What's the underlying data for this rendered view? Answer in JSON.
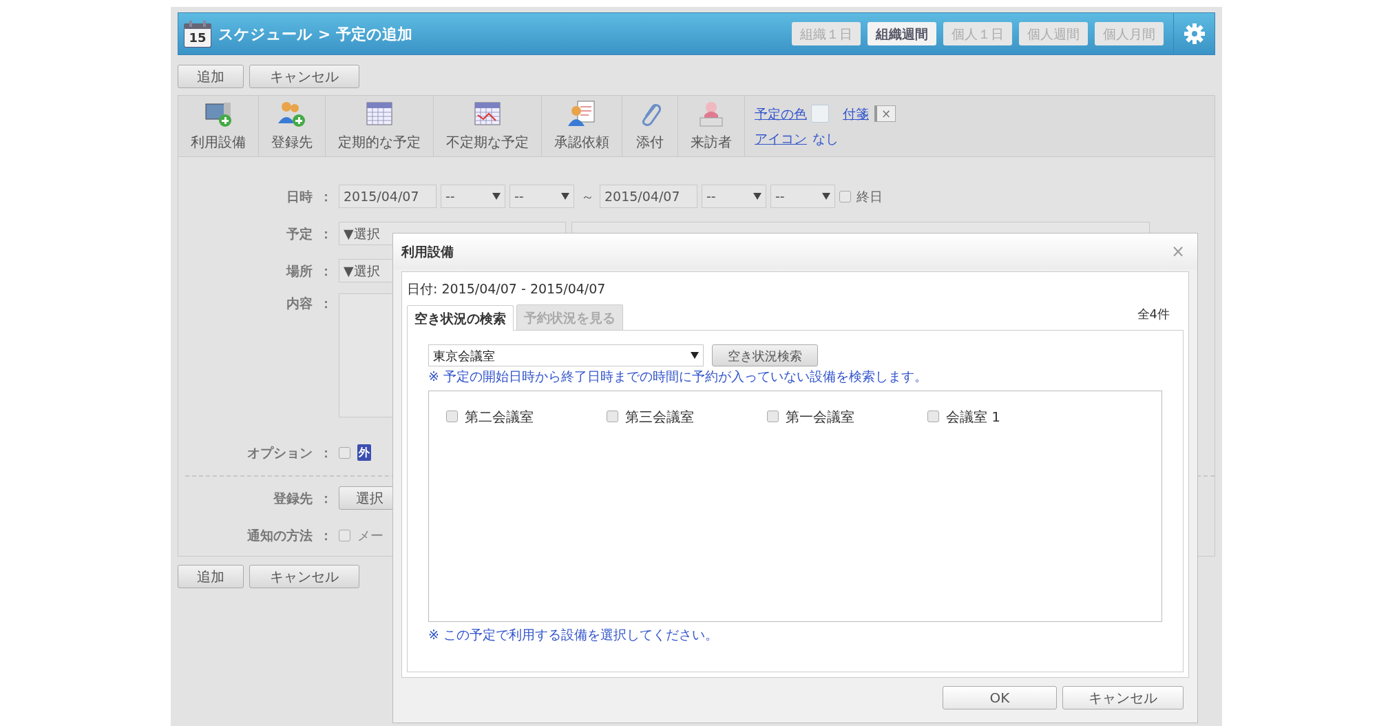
{
  "header": {
    "calendar_day": "15",
    "title": "スケジュール > 予定の追加",
    "view_buttons": [
      {
        "label": "組織１日",
        "selected": false
      },
      {
        "label": "組織週間",
        "selected": true
      },
      {
        "label": "個人１日",
        "selected": false
      },
      {
        "label": "個人週間",
        "selected": false
      },
      {
        "label": "個人月間",
        "selected": false
      }
    ]
  },
  "top_buttons": [
    "追加",
    "キャンセル"
  ],
  "toolbar": {
    "items": [
      {
        "label": "利用設備",
        "kind": "monitor"
      },
      {
        "label": "登録先",
        "kind": "people"
      },
      {
        "label": "定期的な予定",
        "kind": "calendar"
      },
      {
        "label": "不定期な予定",
        "kind": "calendar-irregular"
      },
      {
        "label": "承認依頼",
        "kind": "approval"
      },
      {
        "label": "添付",
        "kind": "clip"
      },
      {
        "label": "来訪者",
        "kind": "visitor"
      }
    ],
    "color_link": "予定の色",
    "sticky_link": "付箋",
    "sticky_clear": "×",
    "icon_link": "アイコン",
    "icon_value": "なし"
  },
  "form": {
    "rows": [
      {
        "label": "日時",
        "colon": "：",
        "kind": "datetime",
        "start_date": "2015/04/07",
        "start_hour": "--",
        "start_min": "--",
        "separator": "～",
        "end_date": "2015/04/07",
        "end_hour": "--",
        "end_min": "--",
        "allday_label": "終日",
        "allday_checked": false
      },
      {
        "label": "予定",
        "colon": "：",
        "kind": "select",
        "value": "▼選択",
        "side_field": true
      },
      {
        "label": "場所",
        "colon": "：",
        "kind": "select",
        "value": "▼選択"
      },
      {
        "label": "内容",
        "colon": "：",
        "kind": "textarea"
      },
      {
        "label": "オプション",
        "colon": "：",
        "kind": "option",
        "checked": false,
        "badge": "外"
      },
      {
        "label": "登録先",
        "colon": "：",
        "kind": "button",
        "button": "選択"
      },
      {
        "label": "通知の方法",
        "colon": "：",
        "kind": "check",
        "checked": false,
        "text": "メー"
      }
    ]
  },
  "bottom_buttons": [
    "追加",
    "キャンセル"
  ],
  "dialog": {
    "title": "利用設備",
    "close": "×",
    "date_line": "日付: 2015/04/07 - 2015/04/07",
    "tabs": [
      {
        "label": "空き状況の検索",
        "selected": true
      },
      {
        "label": "予約状況を見る",
        "selected": false
      }
    ],
    "count": "全4件",
    "select_value": "東京会議室",
    "search_button": "空き状況検索",
    "note": "※ 予定の開始日時から終了日時までの時間に予約が入っていない設備を検索します。",
    "facilities": [
      {
        "label": "第二会議室",
        "checked": false
      },
      {
        "label": "第三会議室",
        "checked": false
      },
      {
        "label": "第一会議室",
        "checked": false
      },
      {
        "label": "会議室 1",
        "checked": false
      }
    ],
    "footer_note": "※ この予定で利用する設備を選択してください。",
    "buttons": [
      "OK",
      "キャンセル"
    ]
  }
}
